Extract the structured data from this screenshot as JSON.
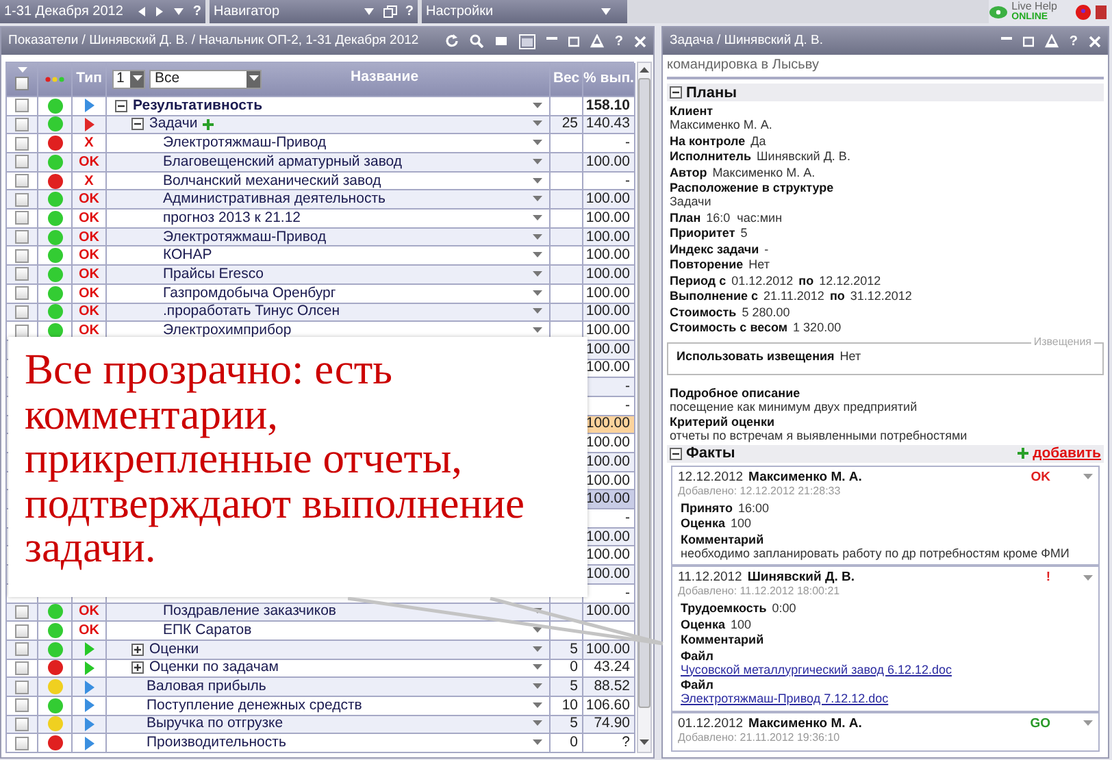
{
  "top_bar": {
    "segments": [
      {
        "kind": "period",
        "label": "1-31 Декабря 2012",
        "help": "?"
      },
      {
        "kind": "navigator",
        "label": "Навигатор",
        "help": "?"
      },
      {
        "kind": "settings",
        "label": "Настройки"
      }
    ],
    "live_help": {
      "label": "Live Help",
      "status": "ONLINE"
    }
  },
  "left_panel": {
    "title": "Показатели / Шинявский Д. В. / Начальник ОП-2, 1-31 Декабря 2012",
    "help": "?",
    "table": {
      "select_all_checked": false,
      "level": "1",
      "filter": "Все",
      "columns": [
        "Тип",
        "Название",
        "Вес",
        "% вып."
      ],
      "rows": [
        {
          "name": "Результативность",
          "checked": false,
          "color": "#33cc33",
          "type": {
            "kind": "arrow",
            "color": "#3a8fe0"
          },
          "percent": "158.10",
          "selected": false,
          "warning": false,
          "expanded": true,
          "children": [
            {
              "name": "Задачи",
              "add_icon": true,
              "checked": false,
              "color": "#33cc33",
              "type": {
                "kind": "arrow",
                "color": "#e02828"
              },
              "weight": "25",
              "percent": "140.43",
              "selected": false,
              "warning": false,
              "expanded": true,
              "children": [
                {
                  "name": "Электротяжмаш-Привод",
                  "checked": false,
                  "color": "#e02020",
                  "type": {
                    "kind": "text",
                    "text": "X"
                  },
                  "percent": "-",
                  "selected": false,
                  "warning": false
                },
                {
                  "name": "Благовещенский арматурный завод",
                  "checked": false,
                  "color": "#33cc33",
                  "type": {
                    "kind": "text",
                    "text": "OK"
                  },
                  "percent": "100.00",
                  "selected": false,
                  "warning": false
                },
                {
                  "name": "Волчанский механический завод",
                  "checked": false,
                  "color": "#e02020",
                  "type": {
                    "kind": "text",
                    "text": "X"
                  },
                  "percent": "-",
                  "selected": false,
                  "warning": false
                },
                {
                  "name": "Административная деятельность",
                  "checked": false,
                  "color": "#33cc33",
                  "type": {
                    "kind": "text",
                    "text": "OK"
                  },
                  "percent": "100.00",
                  "selected": false,
                  "warning": false
                },
                {
                  "name": "прогноз 2013 к 21.12",
                  "checked": false,
                  "color": "#33cc33",
                  "type": {
                    "kind": "text",
                    "text": "OK"
                  },
                  "percent": "100.00",
                  "selected": false,
                  "warning": false
                },
                {
                  "name": "Электротяжмаш-Привод",
                  "checked": false,
                  "color": "#33cc33",
                  "type": {
                    "kind": "text",
                    "text": "OK"
                  },
                  "percent": "100.00",
                  "selected": false,
                  "warning": false
                },
                {
                  "name": "КОНАР",
                  "checked": false,
                  "color": "#33cc33",
                  "type": {
                    "kind": "text",
                    "text": "OK"
                  },
                  "percent": "100.00",
                  "selected": false,
                  "warning": false
                },
                {
                  "name": "Прайсы Eresco",
                  "checked": false,
                  "color": "#33cc33",
                  "type": {
                    "kind": "text",
                    "text": "OK"
                  },
                  "percent": "100.00",
                  "selected": false,
                  "warning": false
                },
                {
                  "name": "Газпромдобыча Оренбург",
                  "checked": false,
                  "color": "#33cc33",
                  "type": {
                    "kind": "text",
                    "text": "OK"
                  },
                  "percent": "100.00",
                  "selected": false,
                  "warning": false
                },
                {
                  "name": ".проработать Тинус Олсен",
                  "checked": false,
                  "color": "#33cc33",
                  "type": {
                    "kind": "text",
                    "text": "OK"
                  },
                  "percent": "100.00",
                  "selected": false,
                  "warning": false
                },
                {
                  "name": "Электрохимприбор",
                  "checked": false,
                  "color": "#33cc33",
                  "type": {
                    "kind": "text",
                    "text": "OK"
                  },
                  "percent": "100.00",
                  "selected": false,
                  "warning": false
                },
                {
                  "percent": "100.00",
                  "selected": false,
                  "warning": false
                },
                {
                  "percent": "100.00",
                  "selected": false,
                  "warning": false
                },
                {
                  "percent": "-",
                  "selected": false,
                  "warning": false
                },
                {
                  "percent": "-",
                  "selected": false,
                  "warning": false
                },
                {
                  "percent": "100.00",
                  "selected": false,
                  "warning": true
                },
                {
                  "percent": "100.00",
                  "selected": false,
                  "warning": false
                },
                {
                  "percent": "100.00",
                  "selected": false,
                  "warning": false
                },
                {
                  "percent": "100.00",
                  "selected": false,
                  "warning": false
                },
                {
                  "percent": "100.00",
                  "selected": true,
                  "warning": false
                },
                {
                  "percent": "-",
                  "selected": false,
                  "warning": false
                },
                {
                  "percent": "100.00",
                  "selected": false,
                  "warning": false
                },
                {
                  "percent": "100.00",
                  "selected": false,
                  "warning": false
                },
                {
                  "percent": "100.00",
                  "selected": false,
                  "warning": false
                },
                {
                  "percent": "-",
                  "selected": false,
                  "warning": false
                },
                {
                  "name": "Поздравление заказчиков",
                  "checked": false,
                  "color": "#33cc33",
                  "type": {
                    "kind": "text",
                    "text": "OK"
                  },
                  "percent": "100.00",
                  "selected": false,
                  "warning": false
                },
                {
                  "name": "ЕПК Саратов",
                  "checked": false,
                  "color": "#33cc33",
                  "type": {
                    "kind": "text",
                    "text": "OK"
                  },
                  "selected": false,
                  "warning": false
                }
              ]
            },
            {
              "name": "Оценки",
              "checked": false,
              "color": "#33cc33",
              "type": {
                "kind": "arrow",
                "color": "#28c828"
              },
              "weight": "5",
              "percent": "100.00",
              "selected": false,
              "warning": false,
              "expanded": false
            },
            {
              "name": "Оценки по задачам",
              "checked": false,
              "color": "#e02020",
              "type": {
                "kind": "arrow",
                "color": "#28c828"
              },
              "weight": "0",
              "percent": "43.24",
              "selected": false,
              "warning": false,
              "expanded": false
            },
            {
              "name": "Валовая прибыль",
              "checked": false,
              "color": "#f0d020",
              "type": {
                "kind": "arrow",
                "color": "#3a8fe0"
              },
              "weight": "5",
              "percent": "88.52",
              "selected": false,
              "warning": false
            },
            {
              "name": "Поступление денежных средств",
              "checked": false,
              "color": "#33cc33",
              "type": {
                "kind": "arrow",
                "color": "#3a8fe0"
              },
              "weight": "10",
              "percent": "106.60",
              "selected": false,
              "warning": false
            },
            {
              "name": "Выручка по отгрузке",
              "checked": false,
              "color": "#f0d020",
              "type": {
                "kind": "arrow",
                "color": "#3a8fe0"
              },
              "weight": "5",
              "percent": "74.90",
              "selected": false,
              "warning": false
            },
            {
              "name": "Производительность",
              "checked": false,
              "color": "#e02020",
              "type": {
                "kind": "arrow",
                "color": "#3a8fe0"
              },
              "weight": "0",
              "percent": "?",
              "selected": false,
              "warning": false
            }
          ]
        }
      ]
    }
  },
  "callout": {
    "text": "Все прозрачно: есть комментарии, прикрепленные отчеты, подтверждают выполнение задачи."
  },
  "right_panel": {
    "title": "Задача / Шинявский Д. В.",
    "help": "?",
    "subject": "командировка в Лысьву",
    "plans": {
      "title": "Планы",
      "expanded": true,
      "fields": [
        {
          "kind": "stacked",
          "label": "Клиент",
          "value": "Максименко М. А."
        },
        {
          "kind": "inline",
          "label": "На контроле",
          "value": "Да"
        },
        {
          "kind": "inline",
          "label": "Исполнитель",
          "value": "Шинявский Д. В."
        },
        {
          "kind": "inline",
          "label": "Автор",
          "value": "Максименко М. А."
        },
        {
          "kind": "stacked",
          "label": "Расположение в структуре",
          "value": "Задачи"
        },
        {
          "kind": "inline",
          "label": "План",
          "value": "16:0  час:мин"
        },
        {
          "kind": "inline",
          "label": "Приоритет",
          "value": "5"
        },
        {
          "kind": "inline",
          "label": "Индекс задачи",
          "value": "-"
        },
        {
          "kind": "inline",
          "label": "Повторение",
          "value": "Нет"
        },
        {
          "kind": "range",
          "label": "Период с",
          "value": "01.12.2012",
          "separator": "по",
          "value_to": "12.12.2012"
        },
        {
          "kind": "range",
          "label": "Выполнение с",
          "value": "21.11.2012",
          "separator": "по",
          "value_to": "31.12.2012"
        },
        {
          "kind": "inline",
          "label": "Стоимость",
          "value": "5 280.00"
        },
        {
          "kind": "inline",
          "label": "Стоимость с весом",
          "value": "1 320.00"
        }
      ],
      "notices": {
        "legend": "Извещения",
        "label": "Использовать извещения",
        "value": "Нет"
      },
      "details": [
        {
          "kind": "stacked",
          "label": "Подробное описание",
          "value": "посещение как минимум двух предприятий"
        },
        {
          "kind": "stacked",
          "label": "Критерий оценки",
          "value": "отчеты по встречам я выявленными потребностями"
        }
      ]
    },
    "facts": {
      "title": "Факты",
      "expanded": true,
      "add_label": "добавить",
      "items": [
        {
          "date": "12.12.2012",
          "author": "Максименко М. А.",
          "status": "OK",
          "color": "#e02020",
          "added": "Добавлено: 12.12.2012 21:28:33",
          "fields": [
            {
              "kind": "inline",
              "label": "Принято",
              "value": "16:00"
            },
            {
              "kind": "inline",
              "label": "Оценка",
              "value": "100"
            },
            {
              "kind": "stacked",
              "label": "Комментарий",
              "value": "необходимо запланировать работу по др потребностям кроме ФМИ"
            }
          ]
        },
        {
          "date": "11.12.2012",
          "author": "Шинявский Д. В.",
          "status": "!",
          "color": "#e02020",
          "added": "Добавлено: 11.12.2012 18:00:21",
          "fields": [
            {
              "kind": "inline",
              "label": "Трудоемкость",
              "value": "0:00"
            },
            {
              "kind": "inline",
              "label": "Оценка",
              "value": "100"
            },
            {
              "kind": "stacked",
              "label": "Комментарий"
            },
            {
              "kind": "file",
              "label": "Файл",
              "value": "Чусовской металлургический завод 6.12.12.doc"
            },
            {
              "kind": "file",
              "label": "Файл",
              "value": "Электротяжмаш-Привод 7.12.12.doc"
            }
          ]
        },
        {
          "date": "01.12.2012",
          "author": "Максименко М. А.",
          "status": "GO",
          "color": "#2a9a2a",
          "added": "Добавлено: 21.11.2012 19:36:10"
        }
      ]
    }
  }
}
